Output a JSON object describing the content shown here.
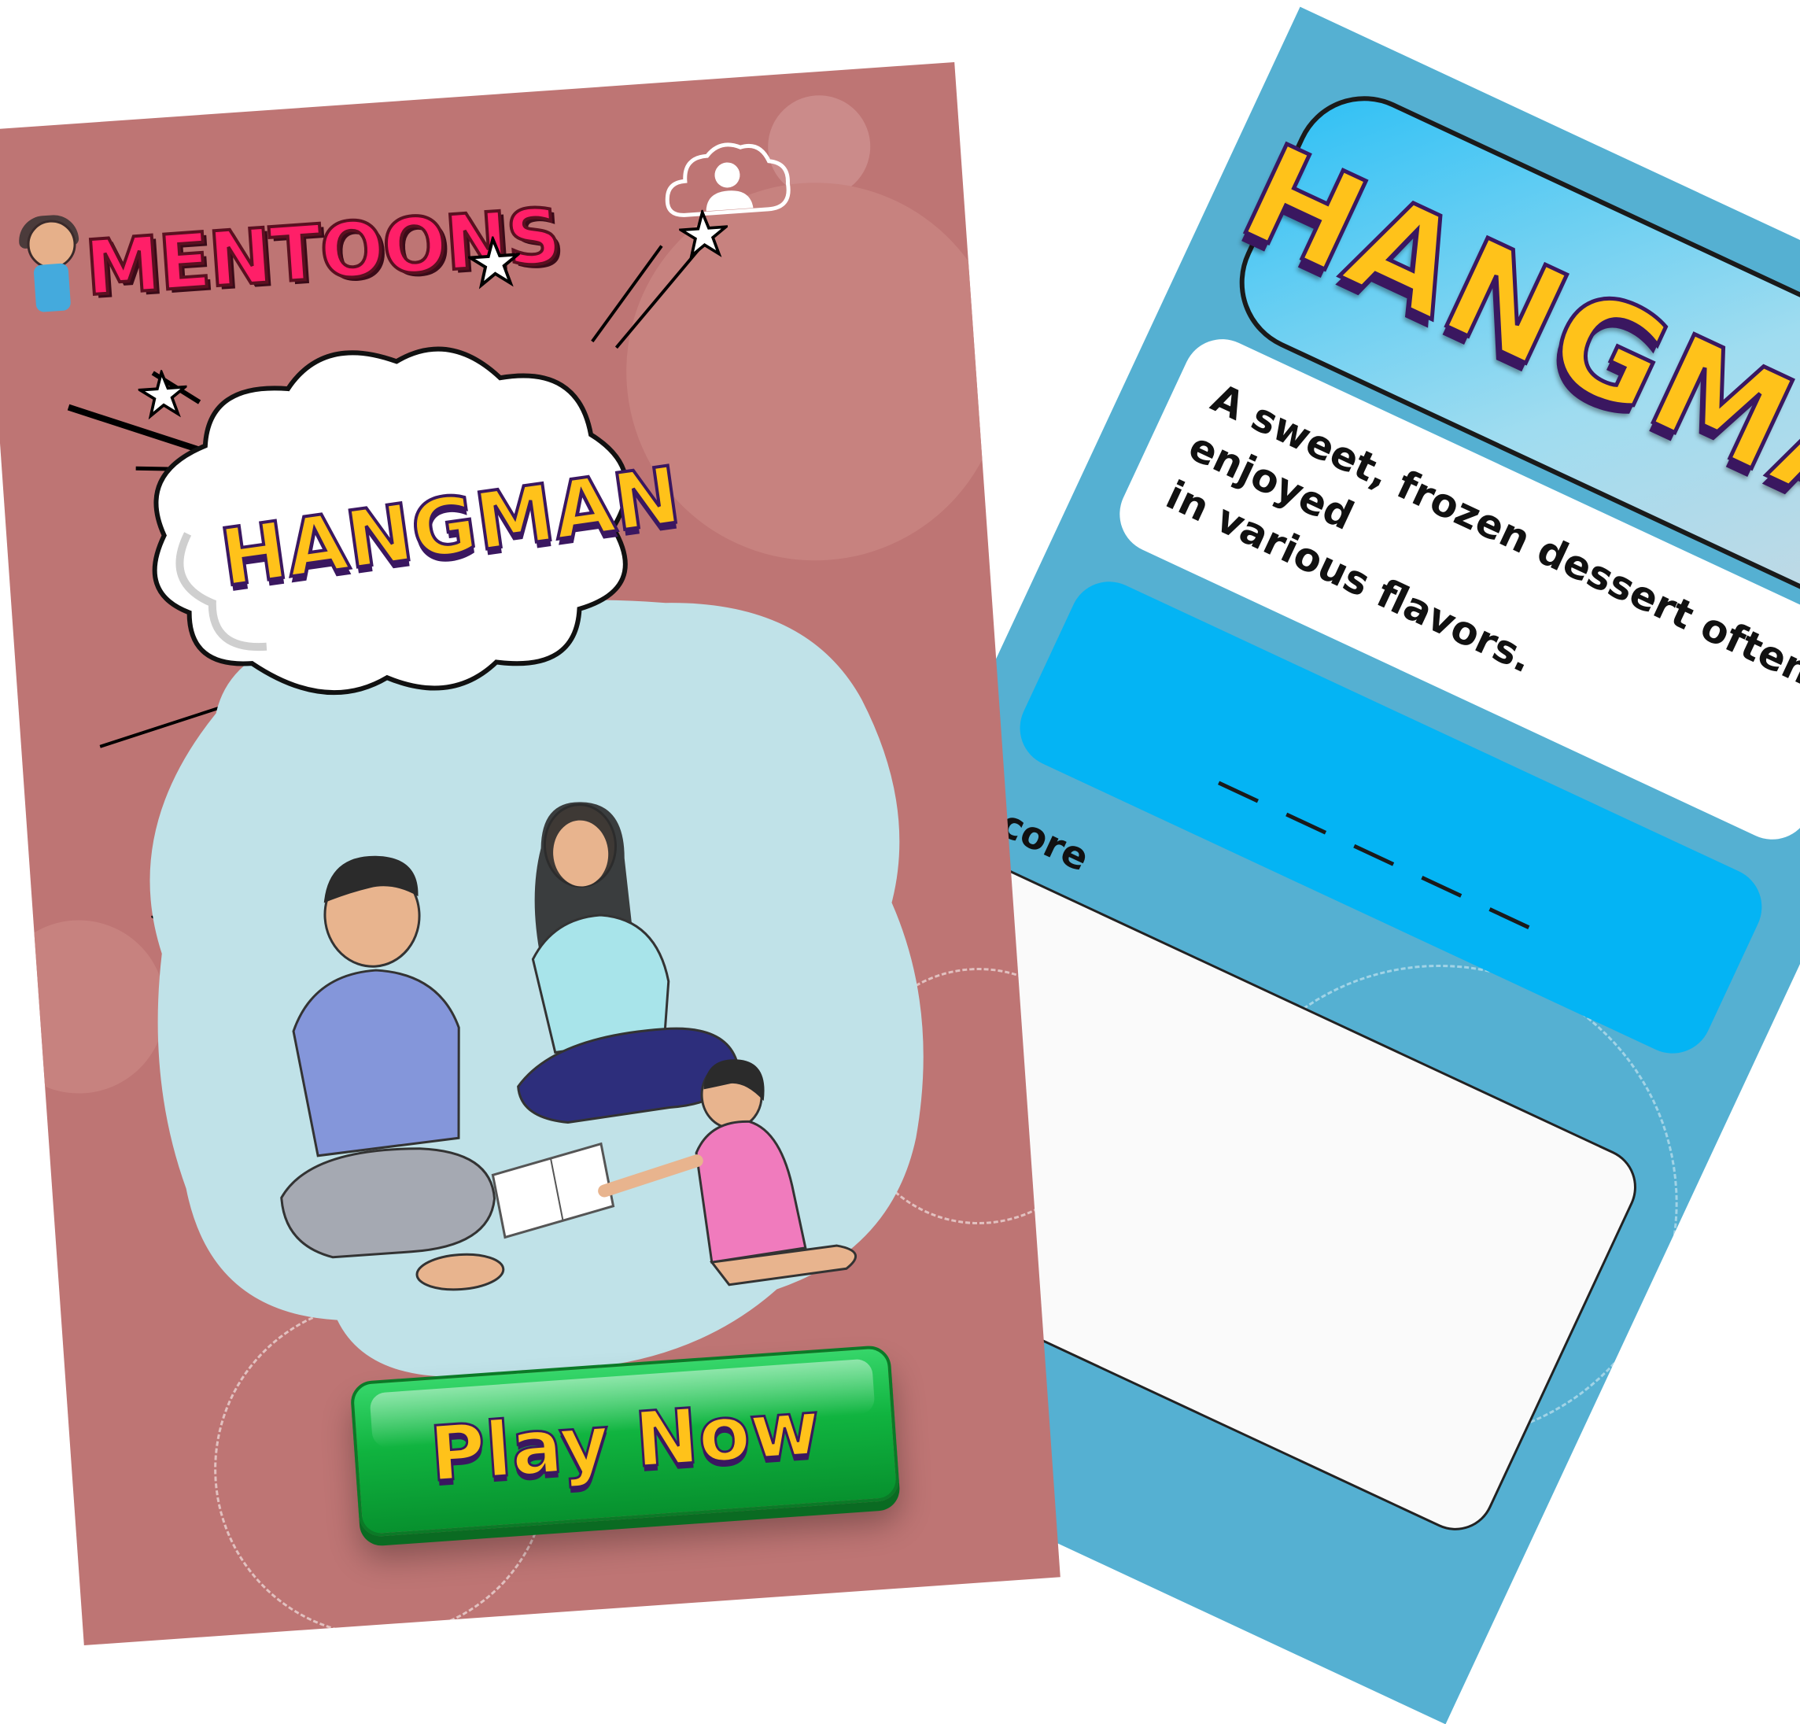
{
  "back_screen": {
    "title": "HANGMAN",
    "clue_line1": "A sweet, frozen dessert often enjoyed",
    "clue_line2": "in various flavors.",
    "word_blank_count": 5,
    "answer_label": "Score",
    "colors": {
      "background": "#55b0d2",
      "word_box": "#04b4f4",
      "title_fill": "#ffc21a",
      "title_outline": "#3a1760"
    }
  },
  "start_screen": {
    "logo_text": "MENTOONS",
    "cloud_title": "HANGMAN",
    "play_button_label": "Play Now",
    "icons": {
      "profile": "user-profile-icon",
      "stars": "star-icon"
    },
    "colors": {
      "background": "#be7574",
      "blob": "#c0e2e8",
      "button": "#10b33f",
      "logo": "#ff1f68"
    }
  }
}
